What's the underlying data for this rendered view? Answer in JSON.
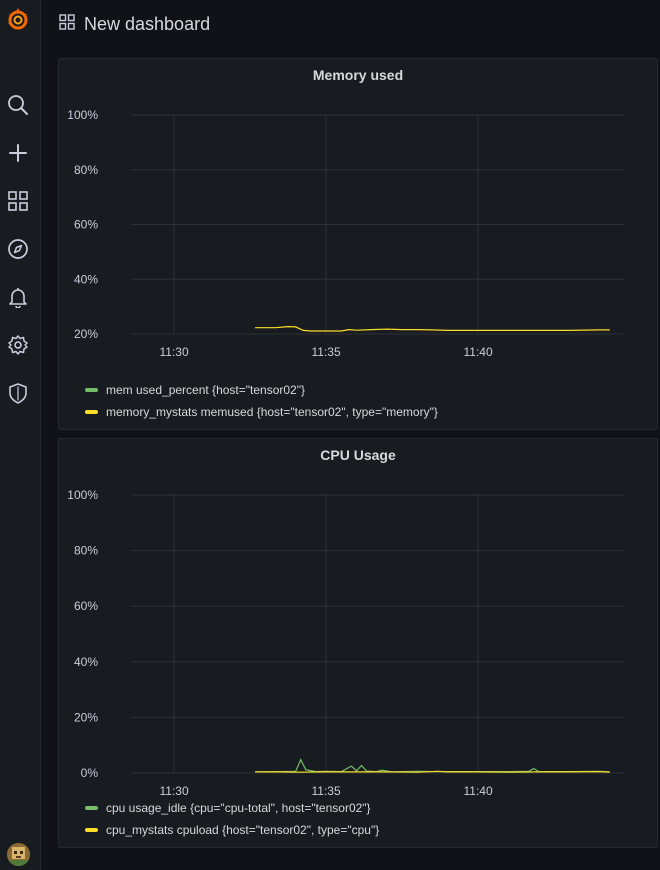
{
  "app": {
    "accent_color": "#f46800",
    "sidebar_icons": [
      "grafana-logo-icon",
      "search-icon",
      "plus-icon",
      "dashboards-icon",
      "explore-compass-icon",
      "alerting-bell-icon",
      "configuration-gear-icon",
      "server-admin-shield-icon",
      "user-avatar"
    ]
  },
  "header": {
    "title": "New dashboard"
  },
  "panels": [
    {
      "title": "Memory used",
      "legend": [
        {
          "label": "mem used_percent {host=\"tensor02\"}",
          "color": "#73bf69"
        },
        {
          "label": "memory_mystats memused {host=\"tensor02\", type=\"memory\"}",
          "color": "#fade2a"
        }
      ]
    },
    {
      "title": "CPU Usage",
      "legend": [
        {
          "label": "cpu usage_idle {cpu=\"cpu-total\", host=\"tensor02\"}",
          "color": "#73bf69"
        },
        {
          "label": "cpu_mystats cpuload {host=\"tensor02\", type=\"cpu\"}",
          "color": "#fade2a"
        }
      ]
    }
  ],
  "chart_data": [
    {
      "type": "line",
      "title": "Memory used",
      "x_ticks": [
        "11:30",
        "11:35",
        "11:40"
      ],
      "y_ticks": [
        "20%",
        "40%",
        "60%",
        "80%",
        "100%"
      ],
      "xlim": [
        "11:28:35",
        "11:44:50"
      ],
      "ylim": [
        20,
        100
      ],
      "grid": true,
      "legend_position": "bottom-left",
      "series": [
        {
          "name": "memory_mystats memused {host=\"tensor02\", type=\"memory\"}",
          "color": "#fade2a",
          "x": [
            "11:32:40",
            "11:33:20",
            "11:33:45",
            "11:34:00",
            "11:34:15",
            "11:34:30",
            "11:35:00",
            "11:35:30",
            "11:35:45",
            "11:36:00",
            "11:36:30",
            "11:37:00",
            "11:37:30",
            "11:38:00",
            "11:38:30",
            "11:39:00",
            "11:40:00",
            "11:41:00",
            "11:42:00",
            "11:43:00",
            "11:44:00",
            "11:44:20"
          ],
          "y": [
            22.3,
            22.3,
            22.7,
            22.6,
            21.3,
            21.1,
            21.1,
            21.1,
            21.6,
            21.4,
            21.6,
            21.8,
            21.6,
            21.6,
            21.5,
            21.3,
            21.3,
            21.3,
            21.3,
            21.3,
            21.5,
            21.5
          ]
        }
      ]
    },
    {
      "type": "line",
      "title": "CPU Usage",
      "x_ticks": [
        "11:30",
        "11:35",
        "11:40"
      ],
      "y_ticks": [
        "0%",
        "20%",
        "40%",
        "60%",
        "80%",
        "100%"
      ],
      "xlim": [
        "11:28:35",
        "11:44:50"
      ],
      "ylim": [
        0,
        100
      ],
      "grid": true,
      "legend_position": "bottom-left",
      "series": [
        {
          "name": "cpu usage_idle {cpu=\"cpu-total\", host=\"tensor02\"}",
          "color": "#73bf69",
          "x": [
            "11:32:40",
            "11:33:30",
            "11:34:00",
            "11:34:10",
            "11:34:20",
            "11:34:40",
            "11:35:00",
            "11:35:30",
            "11:35:50",
            "11:36:00",
            "11:36:10",
            "11:36:20",
            "11:36:40",
            "11:36:50",
            "11:37:10",
            "11:37:30",
            "11:38:00",
            "11:38:30",
            "11:39:00",
            "11:40:00",
            "11:41:00",
            "11:41:40",
            "11:41:50",
            "11:42:00",
            "11:43:00",
            "11:44:00",
            "11:44:20"
          ],
          "y": [
            0.4,
            0.5,
            0.6,
            4.8,
            1.2,
            0.5,
            0.6,
            0.5,
            2.5,
            0.8,
            2.7,
            0.7,
            0.5,
            1.0,
            0.4,
            0.5,
            0.6,
            0.5,
            0.5,
            0.5,
            0.5,
            0.6,
            1.6,
            0.5,
            0.5,
            0.6,
            0.4
          ]
        },
        {
          "name": "cpu_mystats cpuload {host=\"tensor02\", type=\"cpu\"}",
          "color": "#fade2a",
          "x": [
            "11:32:40",
            "11:33:30",
            "11:34:00",
            "11:35:00",
            "11:36:00",
            "11:37:00",
            "11:38:00",
            "11:38:40",
            "11:39:00",
            "11:40:00",
            "11:41:00",
            "11:42:00",
            "11:43:00",
            "11:44:00",
            "11:44:20"
          ],
          "y": [
            0.4,
            0.4,
            0.3,
            0.4,
            0.4,
            0.4,
            0.3,
            0.6,
            0.4,
            0.4,
            0.3,
            0.4,
            0.4,
            0.5,
            0.3
          ]
        }
      ]
    }
  ]
}
